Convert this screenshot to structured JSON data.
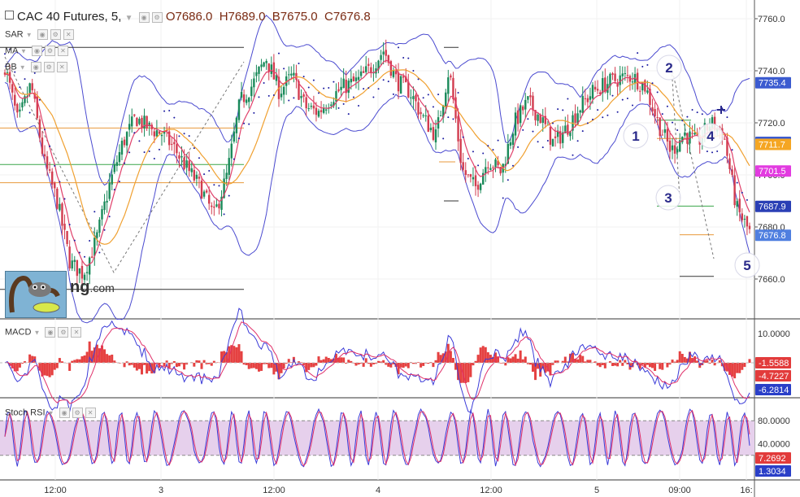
{
  "header": {
    "symbol": "CAC 40 Futures, 5,",
    "open": "O7686.0",
    "high": "H7689.0",
    "low": "B7675.0",
    "close": "C7676.8"
  },
  "indicators": {
    "sar": "SAR",
    "ma": "MA",
    "bb": "BB",
    "macd": "MACD",
    "stoch_rsi": "Stoch RSI"
  },
  "logo": {
    "visible_text": "ng",
    "suffix": ".com"
  },
  "colors": {
    "candle_up": "#1a8a5a",
    "candle_down": "#d23c4f",
    "bb": "#4b4bd0",
    "ma_red": "#e0406a",
    "ma_orange": "#f0a030",
    "sar": "#1a1aa0",
    "macd_line": "#3b3bd8",
    "signal_line": "#e0306a",
    "histogram": "#e02020",
    "stoch_band": "#e6d0ec",
    "hline_orange": "#e89a3c",
    "hline_green": "#3aa64a",
    "hline_black": "#333333"
  },
  "chart_data": [
    {
      "type": "line",
      "title": "CAC 40 Futures, 5",
      "x": [
        "12:00",
        "3",
        "12:00",
        "4",
        "12:00",
        "5",
        "09:00",
        "16:"
      ],
      "ylim": [
        7646,
        7766
      ],
      "yticks": [
        7660.0,
        7680.0,
        7700.0,
        7720.0,
        7740.0,
        7760.0
      ],
      "ytick_labels": [
        "7660.0",
        "7680.0",
        "7700.0",
        "7720.0",
        "7740.0",
        "7760.0"
      ],
      "price_path": [
        7742,
        7720,
        7735,
        7705,
        7690,
        7666,
        7662,
        7675,
        7696,
        7712,
        7722,
        7718,
        7716,
        7710,
        7702,
        7695,
        7684,
        7700,
        7728,
        7735,
        7745,
        7732,
        7738,
        7726,
        7724,
        7730,
        7734,
        7736,
        7741,
        7748,
        7736,
        7732,
        7722,
        7715,
        7741,
        7702,
        7695,
        7706,
        7701,
        7720,
        7728,
        7722,
        7712,
        7718,
        7726,
        7732,
        7735,
        7737,
        7738,
        7734,
        7720,
        7709,
        7716,
        7712,
        7720,
        7716,
        7687,
        7678
      ],
      "price_labels": [
        {
          "label": "7735.4",
          "value": 7735.4,
          "color": "#3b5bd0"
        },
        {
          "label": "7712.5",
          "value": 7712.5,
          "color": "#3b5bd0"
        },
        {
          "label": "7711.7",
          "value": 7711.7,
          "color": "#f5a623"
        },
        {
          "label": "7701.5",
          "value": 7701.5,
          "color": "#e23be0"
        },
        {
          "label": "7687.9",
          "value": 7687.9,
          "color": "#2a3fb5"
        },
        {
          "label": "7676.8",
          "value": 7676.8,
          "color": "#4f7fe0"
        }
      ],
      "elliott_labels": [
        "1",
        "2",
        "3",
        "4",
        "5"
      ]
    },
    {
      "type": "line",
      "title": "MACD",
      "yticks": [
        10.0
      ],
      "ytick_labels": [
        "10.0000"
      ],
      "series_labels": [
        {
          "label": "-1.5588",
          "color": "#e23b3b"
        },
        {
          "label": "-4.7227",
          "color": "#e23b3b"
        },
        {
          "label": "-6.2814",
          "color": "#2a3fc8"
        }
      ]
    },
    {
      "type": "line",
      "title": "Stoch RSI",
      "yticks": [
        80.0,
        40.0
      ],
      "ytick_labels": [
        "80.0000",
        "40.0000"
      ],
      "band": [
        20,
        80
      ],
      "series_labels": [
        {
          "label": "7.2692",
          "color": "#e23b3b"
        },
        {
          "label": "1.3034",
          "color": "#2a3fc8"
        }
      ]
    }
  ]
}
